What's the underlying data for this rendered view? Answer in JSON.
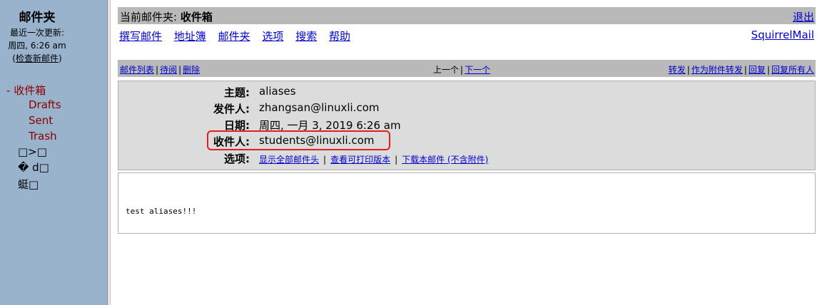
{
  "sidebar": {
    "title": "邮件夹",
    "last_update_label": "最近一次更新:",
    "last_update_time": "周四, 6:26 am",
    "check_mail_open": "(",
    "check_mail_link": "检查新邮件",
    "check_mail_close": ")",
    "folders": [
      {
        "prefix": "- ",
        "label": "收件箱"
      },
      {
        "label": "Drafts"
      },
      {
        "label": "Sent"
      },
      {
        "label": "Trash"
      },
      {
        "label": "□>□"
      },
      {
        "label": "� d□"
      },
      {
        "label": "蜓□"
      }
    ]
  },
  "topbar": {
    "current_folder_label": "当前邮件夹: ",
    "current_folder_name": "收件箱",
    "logout": "退出"
  },
  "nav": {
    "compose": "撰写邮件",
    "addresses": "地址簿",
    "folders": "邮件夹",
    "options": "选项",
    "search": "搜索",
    "help": "帮助",
    "brand": "SquirrelMail"
  },
  "actions": {
    "message_list": "邮件列表",
    "sep": "|",
    "pending": "待阅",
    "delete": "删除",
    "previous": "上一个",
    "next": "下一个",
    "forward": "转发",
    "forward_attachment": "作为附件转发",
    "reply": "回复",
    "reply_all": "回复所有人"
  },
  "message": {
    "subject_label": "主题:",
    "subject": "aliases",
    "from_label": "发件人:",
    "from": "zhangsan@linuxli.com",
    "date_label": "日期:",
    "date": "周四, 一月 3, 2019 6:26 am",
    "to_label": "收件人:",
    "to": "students@linuxli.com",
    "options_label": "选项:",
    "option_full_headers": "显示全部邮件头",
    "option_printable": "查看可打印版本",
    "option_download": "下载本邮件 (不含附件)",
    "option_sep": "|",
    "body": "test aliases!!!"
  },
  "colors": {
    "sidebar_bg": "#99b3cc",
    "bar_bg": "#b9b9b9",
    "header_bg": "#dcdcdc",
    "link": "#0000cc",
    "folder": "#8b0000",
    "highlight": "#e02020"
  }
}
